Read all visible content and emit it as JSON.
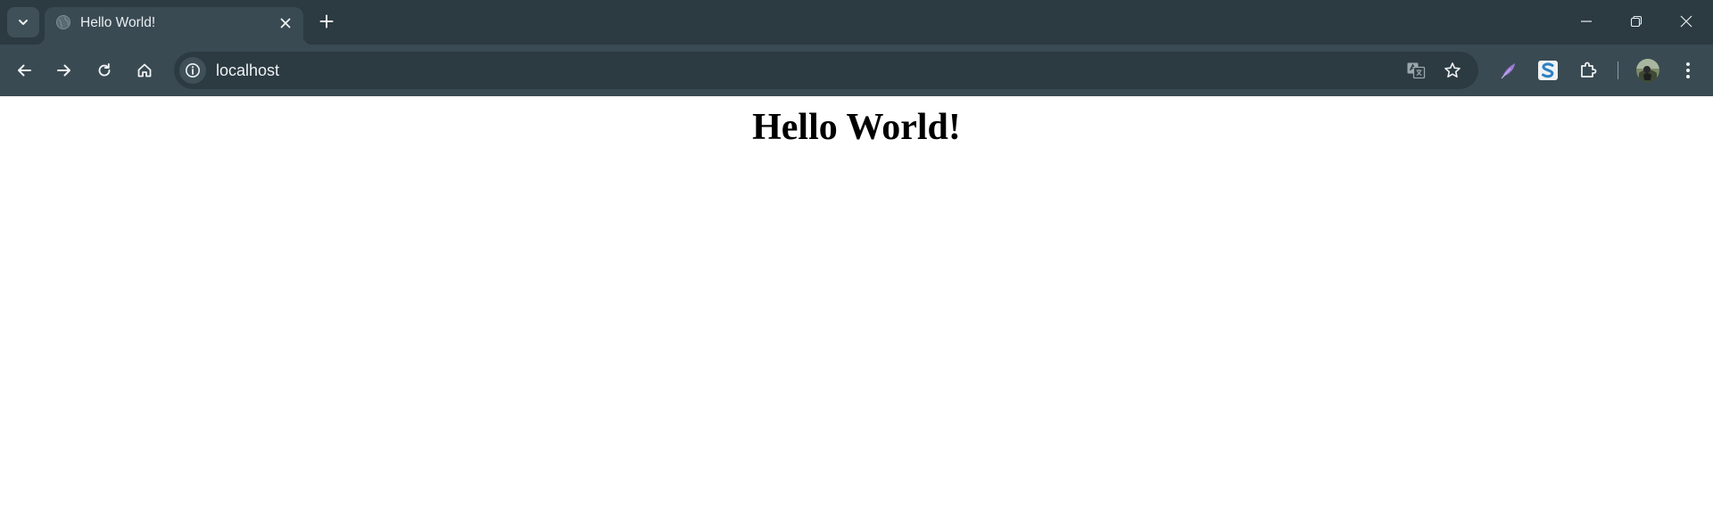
{
  "browser": {
    "tab": {
      "title": "Hello World!"
    },
    "address_bar": {
      "url": "localhost"
    }
  },
  "page": {
    "heading": "Hello World!"
  },
  "icons": {
    "tab_search": "chevron-down-icon",
    "favicon": "globe-icon",
    "tab_close": "close-icon",
    "new_tab": "plus-icon",
    "minimize": "minimize-icon",
    "restore": "restore-icon",
    "close_window": "close-icon",
    "back": "arrow-left-icon",
    "forward": "arrow-right-icon",
    "reload": "reload-icon",
    "home": "home-icon",
    "site_info": "info-icon",
    "translate": "translate-icon",
    "bookmark": "star-icon",
    "extension_1": "feather-icon",
    "extension_2": "s-logo-icon",
    "extensions": "puzzle-icon",
    "profile": "avatar",
    "menu": "more-vertical-icon"
  },
  "colors": {
    "tabstrip_bg": "#2c3a42",
    "toolbar_bg": "#3a4a52",
    "omnibox_bg": "#2c3a42",
    "page_bg": "#ffffff",
    "text_light": "#e8eef1",
    "ext_feather": "#9b7bd4",
    "ext_s": "#4aa3df"
  }
}
